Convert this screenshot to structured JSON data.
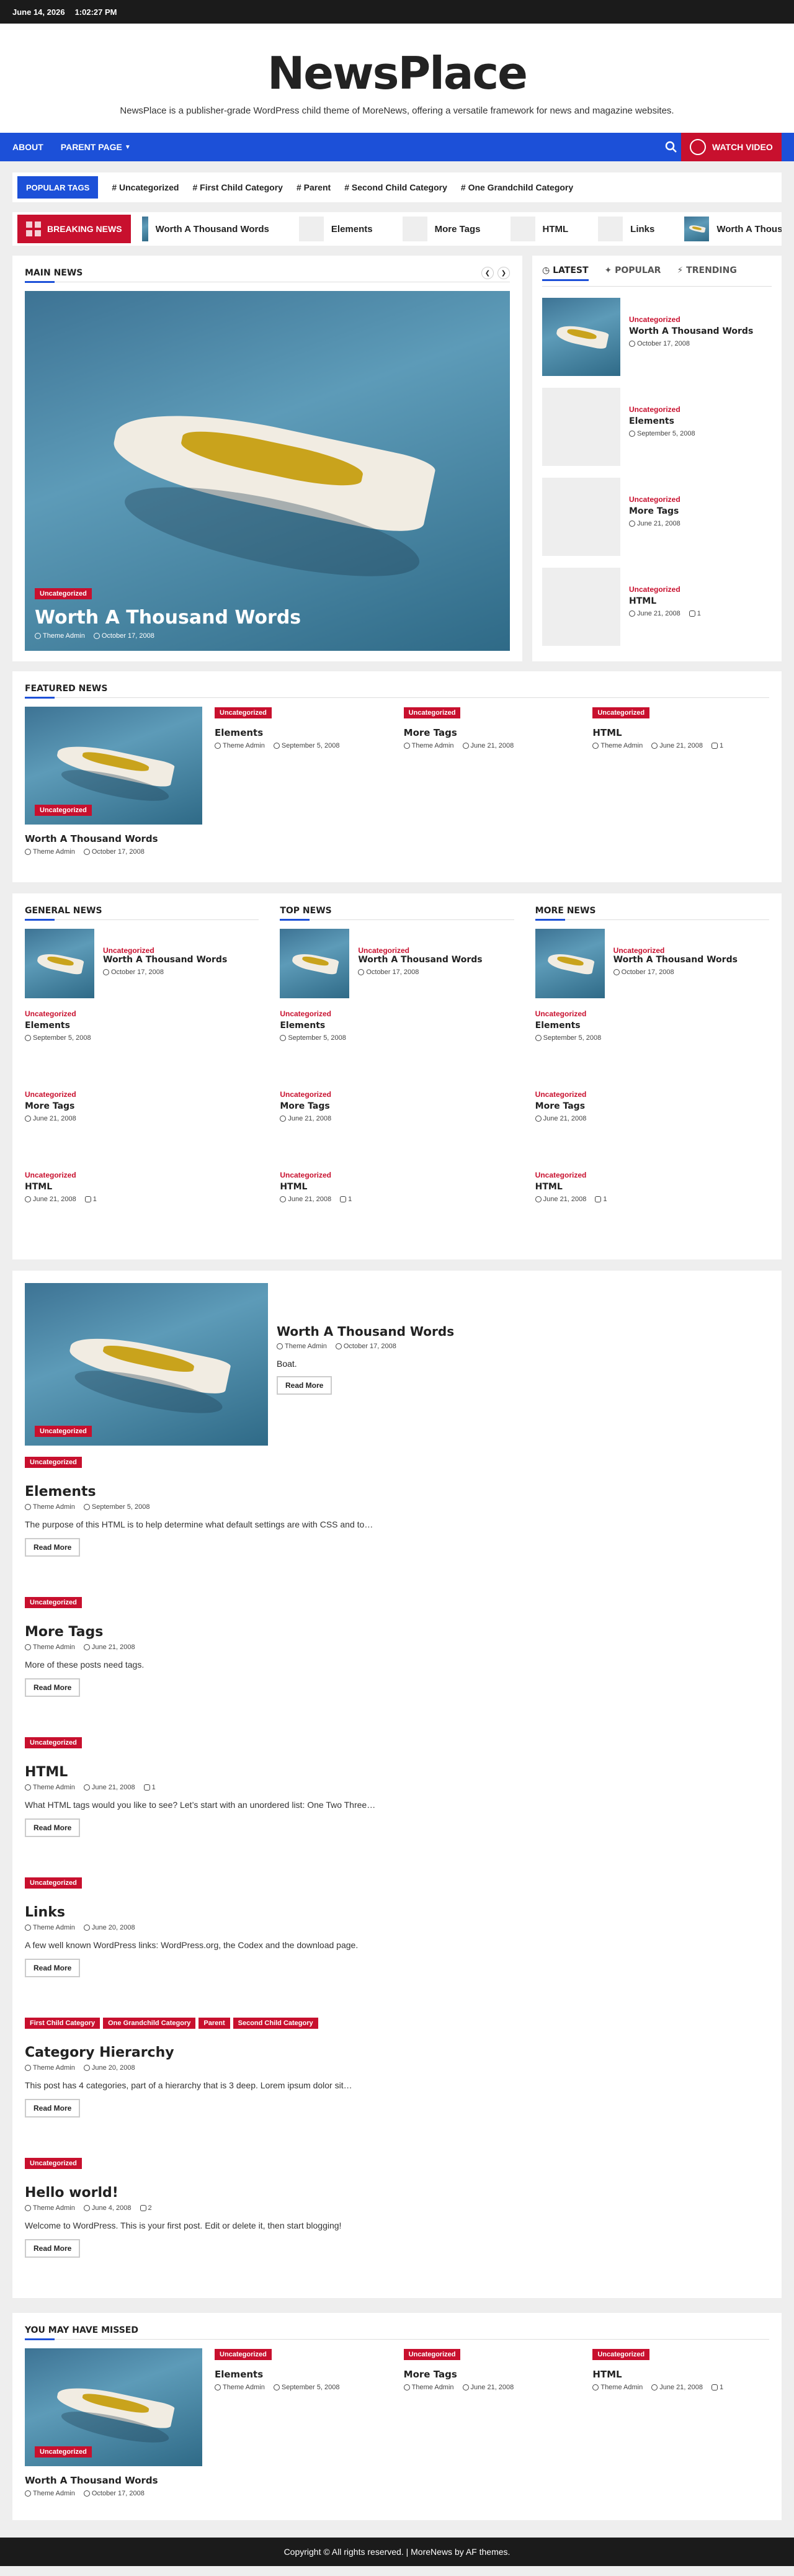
{
  "topbar": {
    "date": "June 14, 2026",
    "time": "1:02:27 PM"
  },
  "site": {
    "title": "NewsPlace",
    "description": "NewsPlace is a publisher-grade WordPress child theme of MoreNews, offering a versatile framework for news and magazine websites."
  },
  "nav": {
    "items": [
      "ABOUT",
      "PARENT PAGE"
    ],
    "watch_label": "WATCH VIDEO"
  },
  "tags": {
    "label": "POPULAR TAGS",
    "items": [
      "# Uncategorized",
      "# First Child Category",
      "# Parent",
      "# Second Child Category",
      "# One Grandchild Category"
    ]
  },
  "breaking": {
    "label": "BREAKING NEWS",
    "items": [
      "Worth A Thousand Words",
      "Elements",
      "More Tags",
      "HTML",
      "Links",
      "Worth A Thousand Words"
    ]
  },
  "main_news": {
    "title": "MAIN NEWS",
    "hero": {
      "cat": "Uncategorized",
      "title": "Worth A Thousand Words",
      "author": "Theme Admin",
      "date": "October 17, 2008"
    }
  },
  "sidebar_tabs": {
    "tabs": [
      "LATEST",
      "POPULAR",
      "TRENDING"
    ],
    "items": [
      {
        "cat": "Uncategorized",
        "title": "Worth A Thousand Words",
        "date": "October 17, 2008",
        "comments": ""
      },
      {
        "cat": "Uncategorized",
        "title": "Elements",
        "date": "September 5, 2008",
        "comments": ""
      },
      {
        "cat": "Uncategorized",
        "title": "More Tags",
        "date": "June 21, 2008",
        "comments": ""
      },
      {
        "cat": "Uncategorized",
        "title": "HTML",
        "date": "June 21, 2008",
        "comments": "1"
      }
    ]
  },
  "featured": {
    "title": "FEATURED NEWS",
    "main": {
      "cat": "Uncategorized",
      "title": "Worth A Thousand Words",
      "author": "Theme Admin",
      "date": "October 17, 2008"
    },
    "items": [
      {
        "cat": "Uncategorized",
        "title": "Elements",
        "author": "Theme Admin",
        "date": "September 5, 2008",
        "comments": ""
      },
      {
        "cat": "Uncategorized",
        "title": "More Tags",
        "author": "Theme Admin",
        "date": "June 21, 2008",
        "comments": ""
      },
      {
        "cat": "Uncategorized",
        "title": "HTML",
        "author": "Theme Admin",
        "date": "June 21, 2008",
        "comments": "1"
      }
    ]
  },
  "columns": [
    {
      "title": "GENERAL NEWS"
    },
    {
      "title": "TOP NEWS"
    },
    {
      "title": "MORE NEWS"
    }
  ],
  "col_items": [
    {
      "cat": "Uncategorized",
      "title": "Worth A Thousand Words",
      "date": "October 17, 2008",
      "comments": ""
    },
    {
      "cat": "Uncategorized",
      "title": "Elements",
      "date": "September 5, 2008",
      "comments": ""
    },
    {
      "cat": "Uncategorized",
      "title": "More Tags",
      "date": "June 21, 2008",
      "comments": ""
    },
    {
      "cat": "Uncategorized",
      "title": "HTML",
      "date": "June 21, 2008",
      "comments": "1"
    }
  ],
  "list": {
    "first": {
      "title": "Worth A Thousand Words",
      "author": "Theme Admin",
      "date": "October 17, 2008",
      "excerpt": "Boat.",
      "cat": "Uncategorized"
    },
    "posts": [
      {
        "cats": [
          "Uncategorized"
        ],
        "title": "Elements",
        "author": "Theme Admin",
        "date": "September 5, 2008",
        "comments": "",
        "excerpt": "The purpose of this HTML is to help determine what default settings are with CSS and to…"
      },
      {
        "cats": [
          "Uncategorized"
        ],
        "title": "More Tags",
        "author": "Theme Admin",
        "date": "June 21, 2008",
        "comments": "",
        "excerpt": "More of these posts need tags."
      },
      {
        "cats": [
          "Uncategorized"
        ],
        "title": "HTML",
        "author": "Theme Admin",
        "date": "June 21, 2008",
        "comments": "1",
        "excerpt": "What HTML tags would you like to see? Let’s start with an unordered list: One Two Three…"
      },
      {
        "cats": [
          "Uncategorized"
        ],
        "title": "Links",
        "author": "Theme Admin",
        "date": "June 20, 2008",
        "comments": "",
        "excerpt": "A few well known WordPress links: WordPress.org, the Codex and the download page."
      },
      {
        "cats": [
          "First Child Category",
          "One Grandchild Category",
          "Parent",
          "Second Child Category"
        ],
        "title": "Category Hierarchy",
        "author": "Theme Admin",
        "date": "June 20, 2008",
        "comments": "",
        "excerpt": "This post has 4 categories, part of a hierarchy that is 3 deep. Lorem ipsum dolor sit…"
      },
      {
        "cats": [
          "Uncategorized"
        ],
        "title": "Hello world!",
        "author": "Theme Admin",
        "date": "June 4, 2008",
        "comments": "2",
        "excerpt": "Welcome to WordPress. This is your first post. Edit or delete it, then start blogging!"
      }
    ],
    "read_more": "Read More"
  },
  "missed": {
    "title": "YOU MAY HAVE MISSED",
    "main": {
      "cat": "Uncategorized",
      "title": "Worth A Thousand Words",
      "author": "Theme Admin",
      "date": "October 17, 2008"
    },
    "items": [
      {
        "cat": "Uncategorized",
        "title": "Elements",
        "author": "Theme Admin",
        "date": "September 5, 2008",
        "comments": ""
      },
      {
        "cat": "Uncategorized",
        "title": "More Tags",
        "author": "Theme Admin",
        "date": "June 21, 2008",
        "comments": ""
      },
      {
        "cat": "Uncategorized",
        "title": "HTML",
        "author": "Theme Admin",
        "date": "June 21, 2008",
        "comments": "1"
      }
    ]
  },
  "footer": {
    "text": "Copyright © All rights reserved. | MoreNews by AF themes."
  },
  "colors": {
    "blue": "#1c50d8",
    "red": "#c8102e",
    "dark": "#1b1b1b"
  }
}
